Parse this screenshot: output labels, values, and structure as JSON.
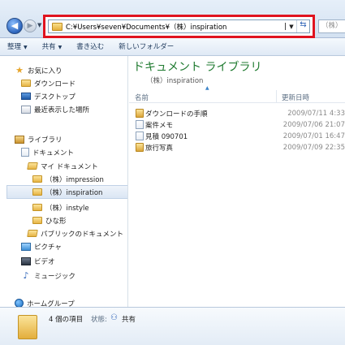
{
  "address": {
    "path": "C:¥Users¥seven¥Documents¥（株）inspiration",
    "search_placeholder": "（株）"
  },
  "toolbar": {
    "organize": "整理",
    "share": "共有",
    "burn": "書き込む",
    "new_folder": "新しいフォルダー"
  },
  "nav": {
    "favorites": "お気に入り",
    "downloads": "ダウンロード",
    "desktop": "デスクトップ",
    "recent": "最近表示した場所",
    "libraries": "ライブラリ",
    "documents": "ドキュメント",
    "my_documents": "マイ ドキュメント",
    "folders": [
      {
        "label": "（株）impression"
      },
      {
        "label": "（株）inspiration"
      },
      {
        "label": "（株）instyle"
      },
      {
        "label": "ひな形"
      }
    ],
    "public_documents": "パブリックのドキュメント",
    "pictures": "ピクチャ",
    "videos": "ビデオ",
    "music": "ミュージック",
    "homegroup": "ホームグループ"
  },
  "main": {
    "library_title": "ドキュメント ライブラリ",
    "folder_subtitle": "（株）inspiration",
    "col_name": "名前",
    "col_date": "更新日時",
    "files": [
      {
        "name": "ダウンロードの手順",
        "date": "2009/07/11 4:33",
        "icon": "locked-file-icon"
      },
      {
        "name": "案件メモ",
        "date": "2009/07/06 21:07",
        "icon": "document-icon"
      },
      {
        "name": "見積 090701",
        "date": "2009/07/01 16:47",
        "icon": "document-icon"
      },
      {
        "name": "旅行写真",
        "date": "2009/07/09 22:35",
        "icon": "shared-folder-icon"
      }
    ]
  },
  "details": {
    "count": "4 個の項目",
    "state_label": "状態:",
    "state": "共有"
  },
  "colors": {
    "highlight_border": "#e0131f",
    "library_title": "#1e7a2f"
  }
}
